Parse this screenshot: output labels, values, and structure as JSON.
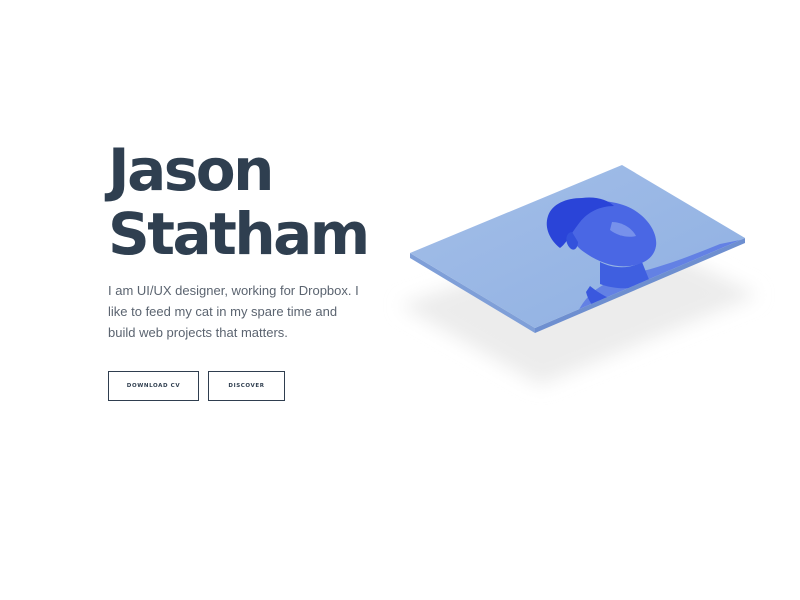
{
  "hero": {
    "name_line1": "Jason",
    "name_line2": "Statham",
    "bio": "I am UI/UX designer, working for Dropbox. I like to feed my cat in my spare time and build web projects that matters."
  },
  "buttons": {
    "download_cv": "DOWNLOAD CV",
    "discover": "DISCOVER"
  },
  "colors": {
    "heading": "#2f3f50",
    "text": "#5b6470",
    "photo_tint": "#3d5be0",
    "photo_background": "#9bb8e6",
    "shadow": "#efefef"
  },
  "illustration": {
    "subject": "isometric-profile-photo",
    "tint": "blue-duotone"
  }
}
